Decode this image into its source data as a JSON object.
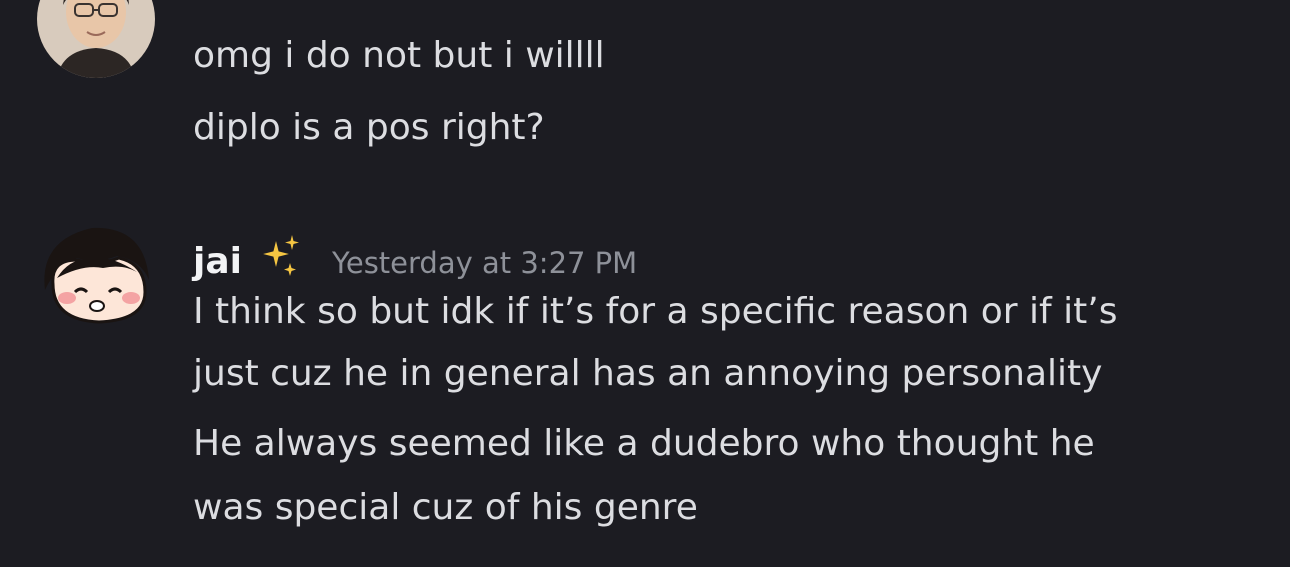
{
  "messages": [
    {
      "username": "",
      "timestamp": "",
      "lines": [
        "omg i do not but i willll",
        "diplo is a pos right?"
      ],
      "avatar": "photo-avatar"
    },
    {
      "username": "jai",
      "badge": "sparkles-icon",
      "timestamp": "Yesterday at 3:27 PM",
      "lines": [
        "I think so but idk if it’s for a specific reason or if it’s",
        "just cuz he in general has an annoying personality",
        "He always seemed like a dudebro who thought he",
        "was special cuz of his genre"
      ],
      "avatar": "cartoon-avatar"
    }
  ],
  "colors": {
    "background": "#1c1c22",
    "text": "#dcdde1",
    "timestamp": "#8e9199",
    "sparkle": "#f5c542"
  }
}
